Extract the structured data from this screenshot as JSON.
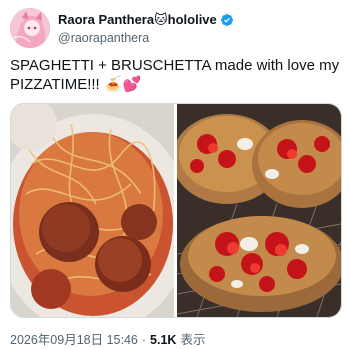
{
  "author": {
    "display_name": "Raora Panthera🐱hololive",
    "handle": "@raorapanthera",
    "verified": true,
    "avatar_icon": "avatar-image"
  },
  "tweet": {
    "text": "SPAGHETTI + BRUSCHETTA made with love my PIZZATIME!!! 🍝💕"
  },
  "media": {
    "photos": [
      {
        "subject": "spaghetti with meatballs"
      },
      {
        "subject": "bruschetta with tomatoes"
      }
    ]
  },
  "meta": {
    "timestamp": "2026年09月18日 15:46",
    "separator": "·",
    "views_count": "5.1K",
    "views_label": "表示"
  },
  "colors": {
    "text": "#0f1419",
    "secondary": "#536471",
    "verified": "#1d9bf0",
    "border": "#cfd9de"
  }
}
